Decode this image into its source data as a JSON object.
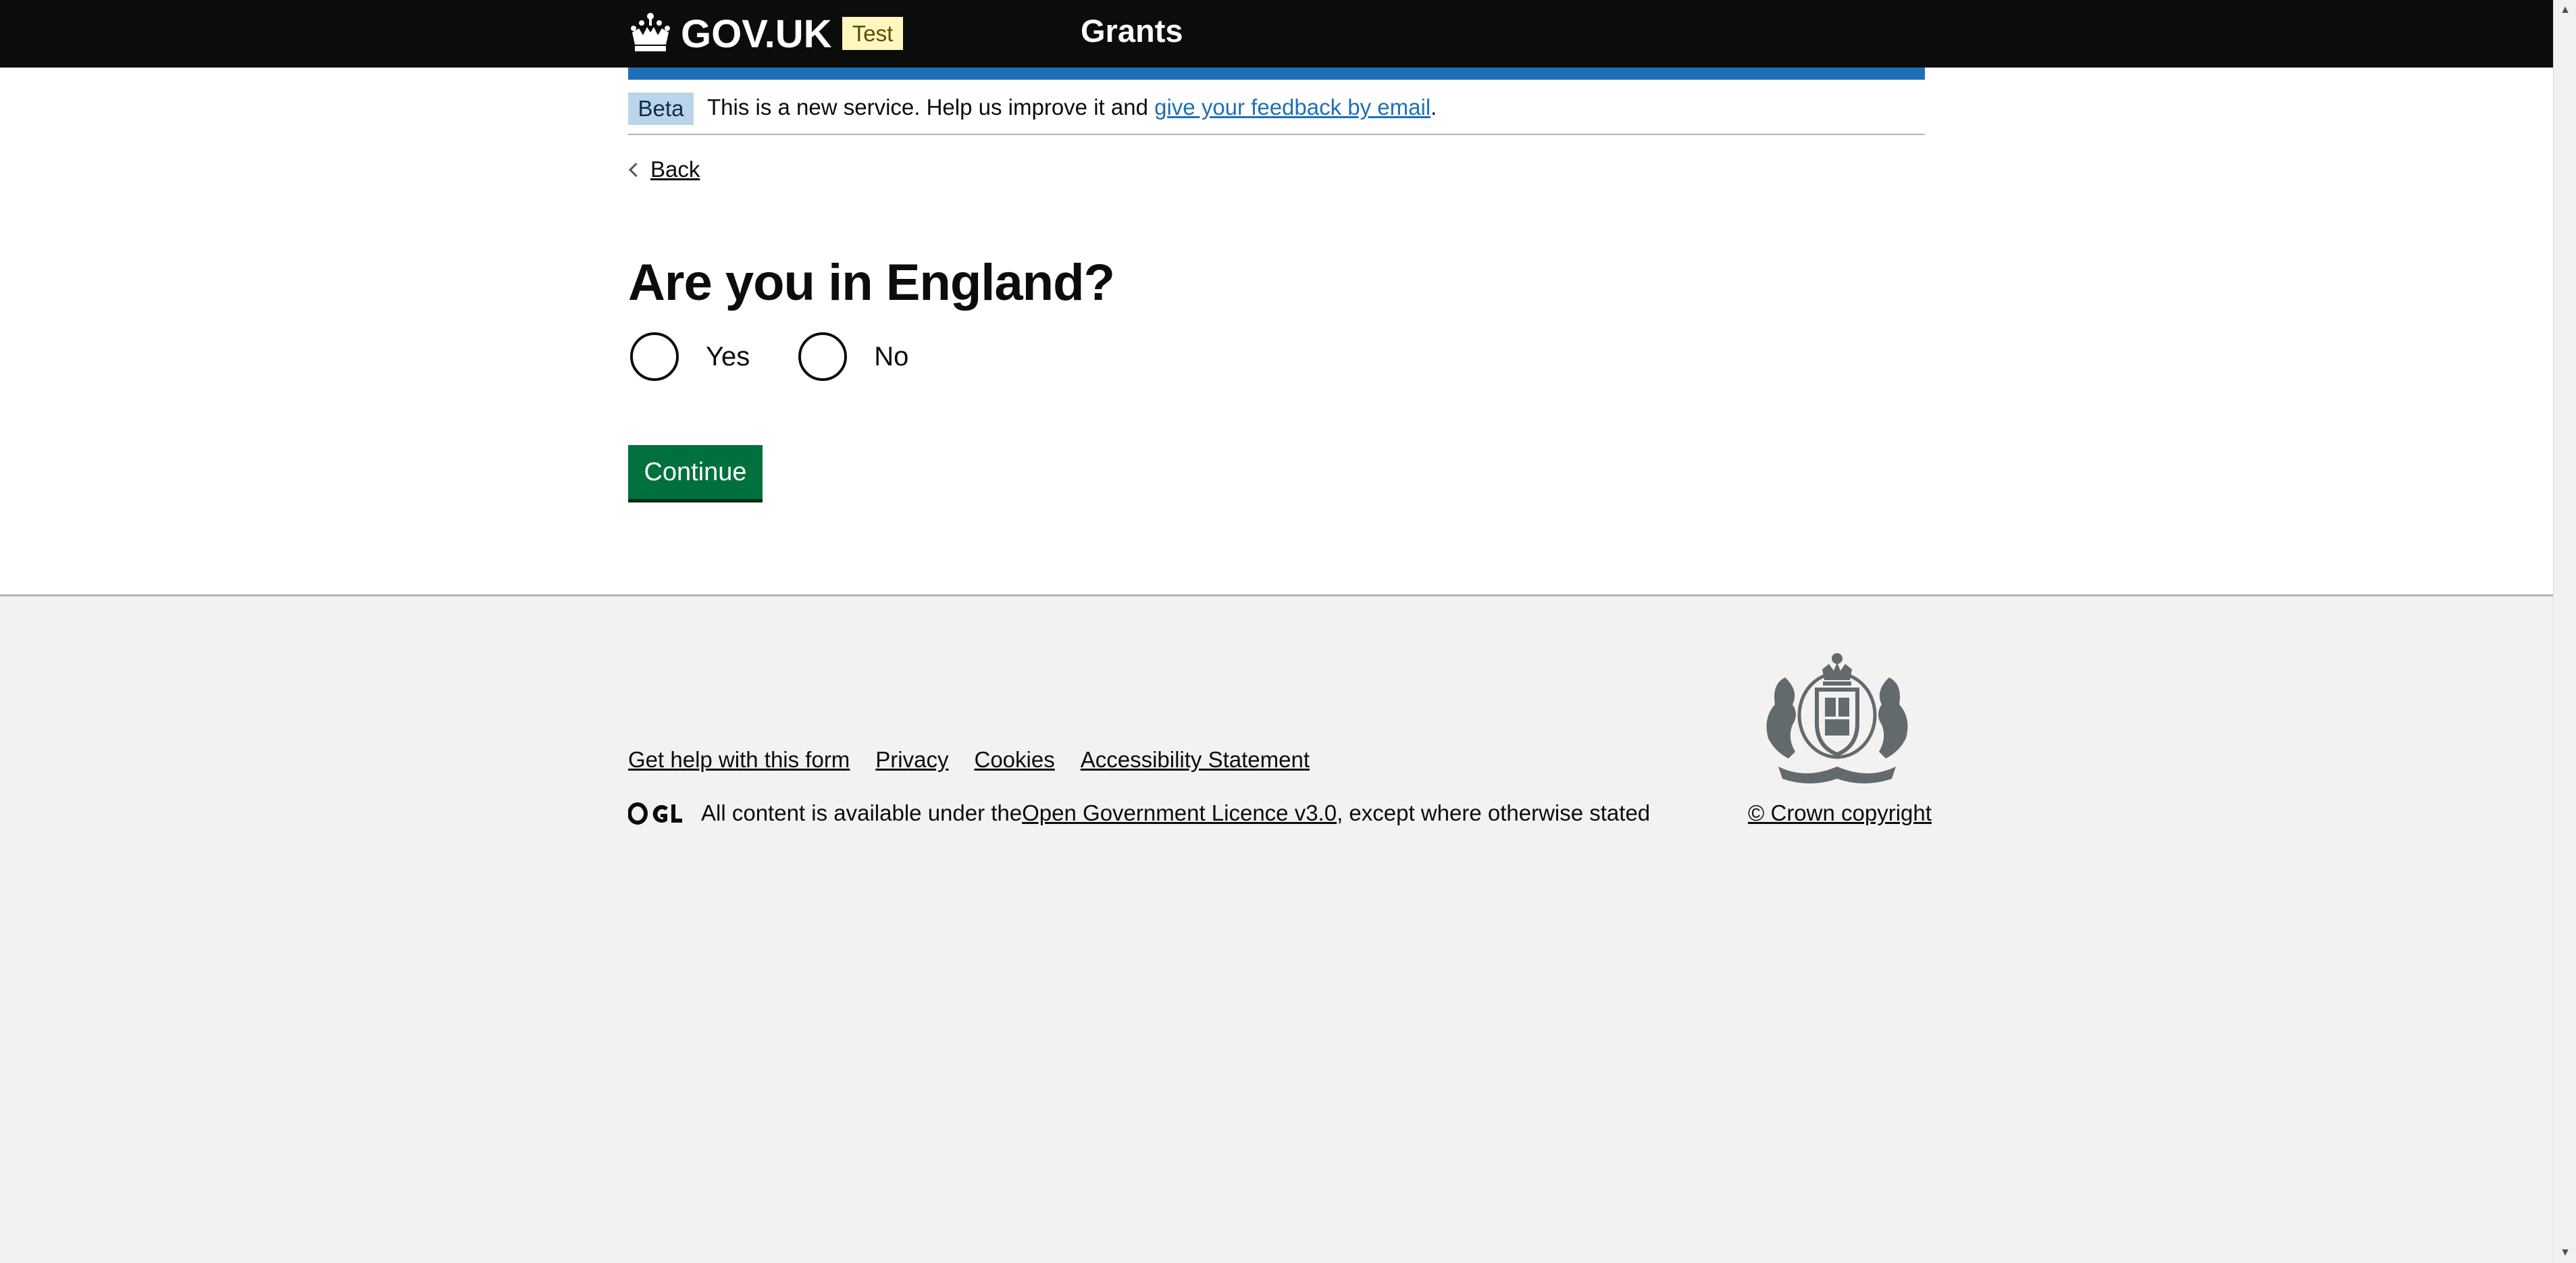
{
  "header": {
    "logotype": "GOV.UK",
    "environment_tag": "Test",
    "service_name": "Grants"
  },
  "phase_banner": {
    "badge": "Beta",
    "text_before": "This is a new service. Help us improve it and ",
    "feedback_link": "give your feedback by email",
    "text_after": "."
  },
  "back_link": "Back",
  "question": {
    "title": "Are you in England?",
    "options": [
      "Yes",
      "No"
    ],
    "selected": null
  },
  "continue_button": "Continue",
  "footer": {
    "links": [
      "Get help with this form",
      "Privacy",
      "Cookies",
      "Accessibility Statement"
    ],
    "licence_before": "All content is available under the ",
    "licence_link": "Open Government Licence v3.0",
    "licence_after": ", except where otherwise stated",
    "copyright": "© Crown copyright"
  },
  "colors": {
    "header_bg": "#0b0c0c",
    "brand_blue": "#1d70b8",
    "button_green": "#00703c",
    "footer_bg": "#f3f2f1",
    "tag_yellow": "#fff7bf",
    "beta_blue": "#bbd4ea"
  }
}
